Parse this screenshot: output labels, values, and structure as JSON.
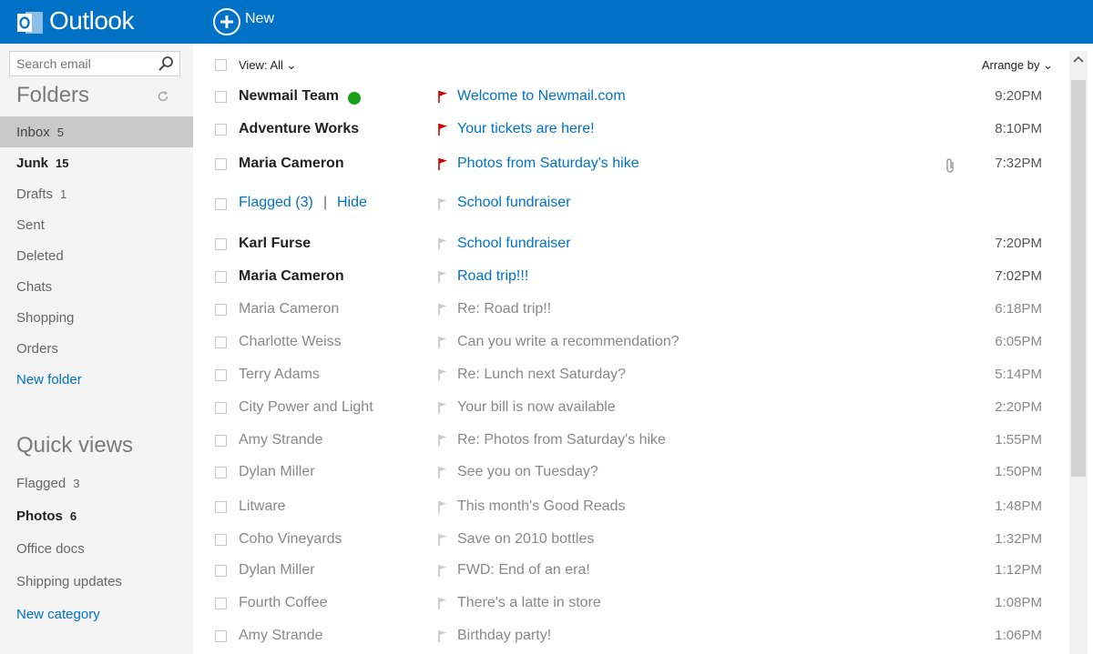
{
  "app": {
    "brand": "Outlook",
    "new_label": "New"
  },
  "colors": {
    "accent": "#0072c6",
    "flag_red": "#d00000",
    "presence": "#18a018"
  },
  "search": {
    "placeholder": "Search email"
  },
  "folders": {
    "title": "Folders",
    "items": [
      {
        "label": "Inbox",
        "count": "5"
      },
      {
        "label": "Junk",
        "count": "15"
      },
      {
        "label": "Drafts",
        "count": "1"
      },
      {
        "label": "Sent",
        "count": ""
      },
      {
        "label": "Deleted",
        "count": ""
      },
      {
        "label": "Chats",
        "count": ""
      },
      {
        "label": "Shopping",
        "count": ""
      },
      {
        "label": "Orders",
        "count": ""
      }
    ],
    "new_folder": "New folder"
  },
  "quick_views": {
    "title": "Quick views",
    "items": [
      {
        "label": "Flagged",
        "count": "3"
      },
      {
        "label": "Photos",
        "count": "6"
      },
      {
        "label": "Office docs",
        "count": ""
      },
      {
        "label": "Shipping updates",
        "count": ""
      }
    ],
    "new_category": "New category"
  },
  "list_header": {
    "view": "View: All",
    "arrange": "Arrange by"
  },
  "flagged_group": {
    "label": "Flagged (3)",
    "separator": "|",
    "hide": "Hide",
    "subject": "School fundraiser"
  },
  "messages": [
    {
      "sender": "Newmail Team",
      "subject": "Welcome to Newmail.com",
      "time": "9:20PM",
      "unread": true,
      "flagged": true
    },
    {
      "sender": "Adventure Works",
      "subject": "Your tickets are here!",
      "time": "8:10PM",
      "unread": true,
      "flagged": true
    },
    {
      "sender": "Maria Cameron",
      "subject": "Photos from Saturday's hike",
      "time": "7:32PM",
      "unread": true,
      "flagged": true
    },
    {
      "sender": "Karl Furse",
      "subject": "School fundraiser",
      "time": "7:20PM",
      "unread": true,
      "flagged": false
    },
    {
      "sender": "Maria Cameron",
      "subject": "Road trip!!!",
      "time": "7:02PM",
      "unread": true,
      "flagged": false
    },
    {
      "sender": "Maria Cameron",
      "subject": "Re: Road trip!!",
      "time": "6:18PM",
      "unread": false,
      "flagged": false
    },
    {
      "sender": "Charlotte Weiss",
      "subject": "Can you write a recommendation?",
      "time": "6:05PM",
      "unread": false,
      "flagged": false
    },
    {
      "sender": "Terry Adams",
      "subject": "Re: Lunch next Saturday?",
      "time": "5:14PM",
      "unread": false,
      "flagged": false
    },
    {
      "sender": "City Power and Light",
      "subject": "Your bill is now available",
      "time": "2:20PM",
      "unread": false,
      "flagged": false
    },
    {
      "sender": "Amy Strande",
      "subject": "Re: Photos from Saturday's hike",
      "time": "1:55PM",
      "unread": false,
      "flagged": false
    },
    {
      "sender": "Dylan Miller",
      "subject": "See you on Tuesday?",
      "time": "1:50PM",
      "unread": false,
      "flagged": false
    },
    {
      "sender": "Litware",
      "subject": "This month's Good Reads",
      "time": "1:48PM",
      "unread": false,
      "flagged": false
    },
    {
      "sender": "Coho Vineyards",
      "subject": "Save on 2010 bottles",
      "time": "1:32PM",
      "unread": false,
      "flagged": false
    },
    {
      "sender": "Dylan Miller",
      "subject": "FWD: End of an era!",
      "time": "1:12PM",
      "unread": false,
      "flagged": false
    },
    {
      "sender": "Fourth Coffee",
      "subject": "There's a latte in store",
      "time": "1:08PM",
      "unread": false,
      "flagged": false
    },
    {
      "sender": "Amy Strande",
      "subject": "Birthday party!",
      "time": "1:06PM",
      "unread": false,
      "flagged": false
    }
  ]
}
